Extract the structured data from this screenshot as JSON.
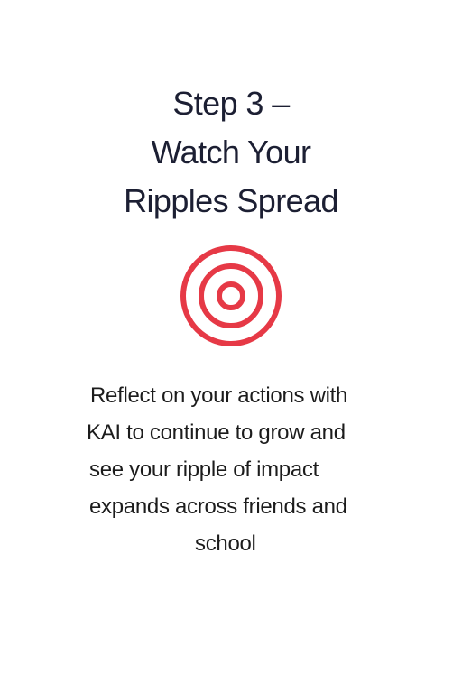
{
  "title": {
    "line1": "Step 3 –",
    "line2": "Watch Your",
    "line3": "Ripples Spread"
  },
  "icon": {
    "name": "concentric-ripple-icon",
    "color": "#e63946"
  },
  "body": {
    "line1": "Reflect on your actions with",
    "line2": "KAI to continue to grow and",
    "line3": "see your ripple of impact",
    "line4": "expands across friends and",
    "line5": "school"
  },
  "colors": {
    "background": "#ffffff",
    "title_text": "#1c1f33",
    "body_text": "#1c1c1c",
    "accent": "#e63946"
  }
}
